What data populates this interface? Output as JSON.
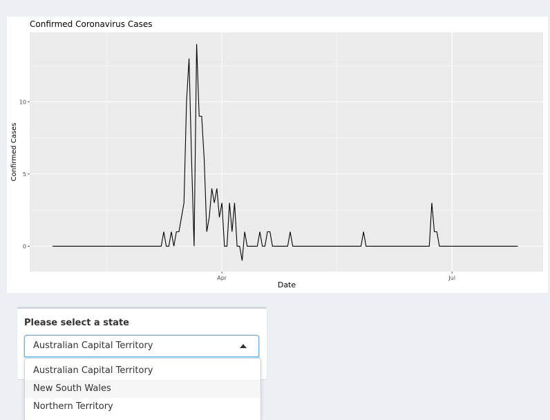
{
  "chart_data": {
    "type": "line",
    "title": "Confirmed Coronavirus Cases",
    "xlabel": "Date",
    "ylabel": "Confirmed Cases",
    "x_tick_labels": [
      {
        "label": "Apr",
        "date": "2020-04-01"
      },
      {
        "label": "Jul",
        "date": "2020-07-01"
      }
    ],
    "y_ticks": [
      0,
      5,
      10
    ],
    "xlim": [
      "2020-01-16",
      "2020-08-06"
    ],
    "ylim": [
      -1.75,
      14.8
    ],
    "grid": true,
    "line_color": "#000000",
    "panel_color": "#ebebeb",
    "grid_color": "#ffffff",
    "series": [
      {
        "points": [
          [
            "2020-01-25",
            0
          ],
          [
            "2020-03-08",
            0
          ],
          [
            "2020-03-09",
            1
          ],
          [
            "2020-03-10",
            0
          ],
          [
            "2020-03-11",
            0
          ],
          [
            "2020-03-12",
            1
          ],
          [
            "2020-03-13",
            0
          ],
          [
            "2020-03-14",
            1
          ],
          [
            "2020-03-15",
            1
          ],
          [
            "2020-03-16",
            2
          ],
          [
            "2020-03-17",
            3
          ],
          [
            "2020-03-18",
            10
          ],
          [
            "2020-03-19",
            13
          ],
          [
            "2020-03-20",
            6
          ],
          [
            "2020-03-21",
            0
          ],
          [
            "2020-03-22",
            14
          ],
          [
            "2020-03-23",
            9
          ],
          [
            "2020-03-24",
            9
          ],
          [
            "2020-03-25",
            6
          ],
          [
            "2020-03-26",
            1
          ],
          [
            "2020-03-27",
            2
          ],
          [
            "2020-03-28",
            4
          ],
          [
            "2020-03-29",
            3
          ],
          [
            "2020-03-30",
            4
          ],
          [
            "2020-03-31",
            2
          ],
          [
            "2020-04-01",
            3
          ],
          [
            "2020-04-02",
            0
          ],
          [
            "2020-04-03",
            0
          ],
          [
            "2020-04-04",
            3
          ],
          [
            "2020-04-05",
            1
          ],
          [
            "2020-04-06",
            3
          ],
          [
            "2020-04-07",
            0
          ],
          [
            "2020-04-08",
            0
          ],
          [
            "2020-04-09",
            -1
          ],
          [
            "2020-04-10",
            1
          ],
          [
            "2020-04-11",
            0
          ],
          [
            "2020-04-15",
            0
          ],
          [
            "2020-04-16",
            1
          ],
          [
            "2020-04-17",
            0
          ],
          [
            "2020-04-18",
            0
          ],
          [
            "2020-04-19",
            1
          ],
          [
            "2020-04-20",
            1
          ],
          [
            "2020-04-21",
            0
          ],
          [
            "2020-04-27",
            0
          ],
          [
            "2020-04-28",
            1
          ],
          [
            "2020-04-29",
            0
          ],
          [
            "2020-05-26",
            0
          ],
          [
            "2020-05-27",
            1
          ],
          [
            "2020-05-28",
            0
          ],
          [
            "2020-06-22",
            0
          ],
          [
            "2020-06-23",
            3
          ],
          [
            "2020-06-24",
            1
          ],
          [
            "2020-06-25",
            1
          ],
          [
            "2020-06-26",
            0
          ],
          [
            "2020-07-27",
            0
          ]
        ]
      }
    ]
  },
  "selector": {
    "label": "Please select a state",
    "selected": "Australian Capital Territory",
    "options": [
      "Australian Capital Territory",
      "New South Wales",
      "Northern Territory"
    ]
  }
}
